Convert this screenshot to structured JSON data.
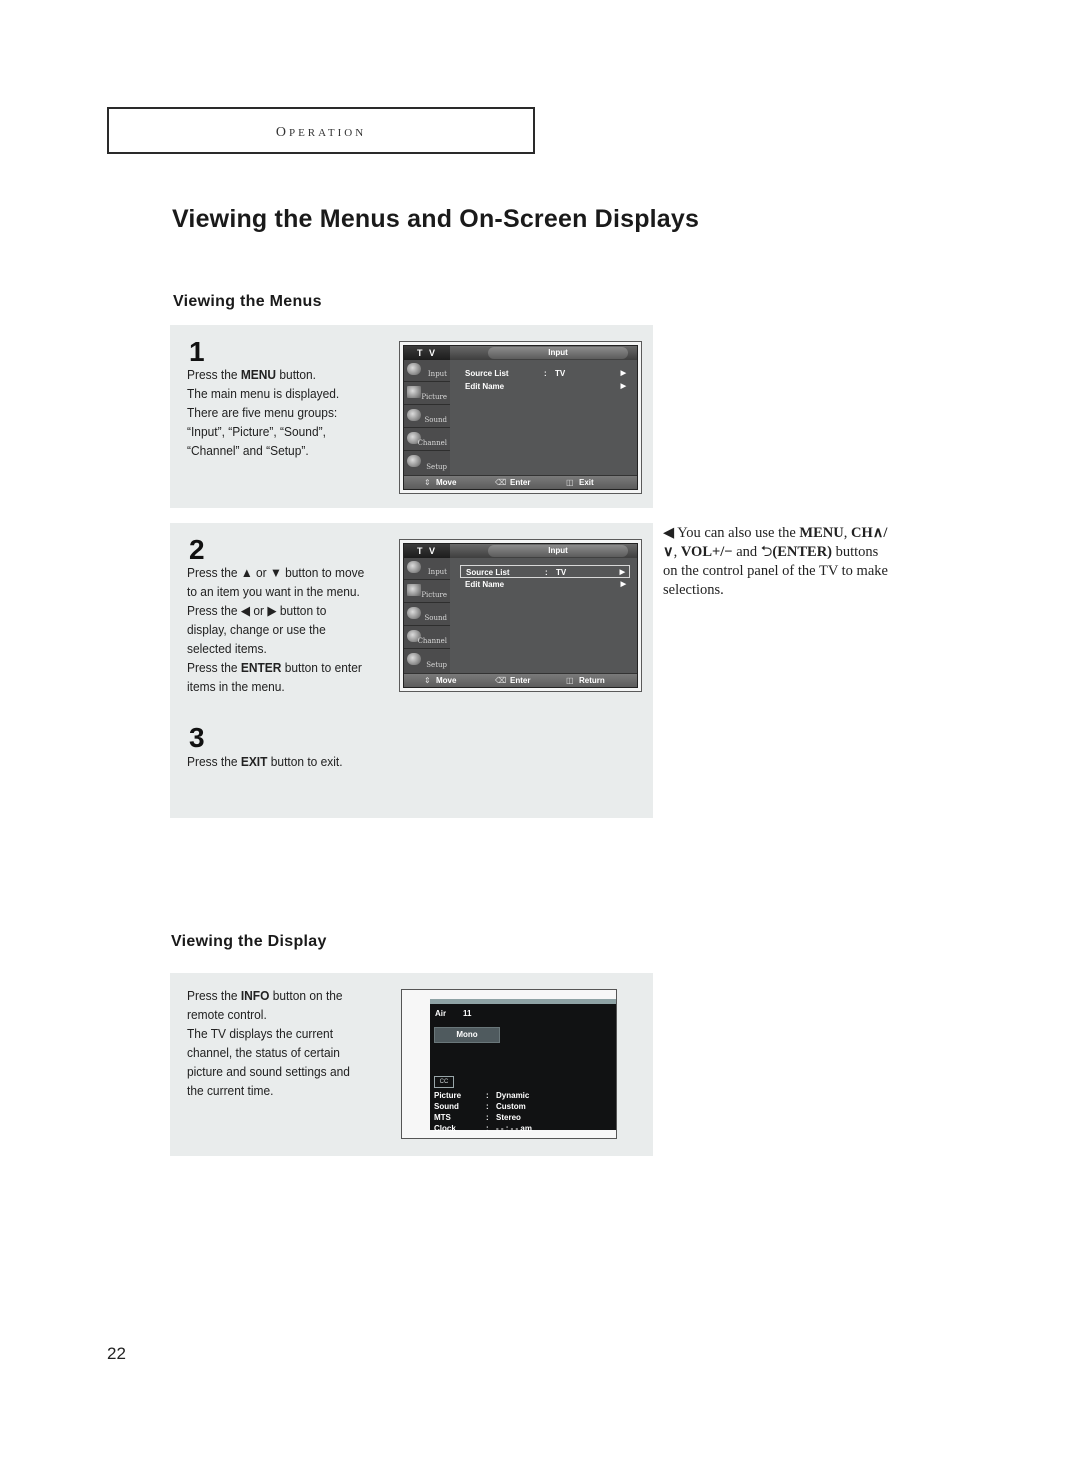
{
  "header": {
    "section_label": "Operation"
  },
  "page_title": "Viewing the Menus and On-Screen Displays",
  "menus_section": {
    "heading": "Viewing the Menus",
    "steps": [
      {
        "number": "1",
        "lines": [
          {
            "pre": "Press the ",
            "bold": "MENU",
            "post": " button."
          },
          {
            "pre": "The main menu is displayed.",
            "bold": "",
            "post": ""
          },
          {
            "pre": "There are five menu groups:",
            "bold": "",
            "post": ""
          },
          {
            "pre": "“Input”, “Picture”, “Sound”,",
            "bold": "",
            "post": ""
          },
          {
            "pre": "“Channel” and “Setup”.",
            "bold": "",
            "post": ""
          }
        ]
      },
      {
        "number": "2",
        "lines": [
          {
            "pre": "Press the ▲ or ▼ button to move",
            "bold": "",
            "post": ""
          },
          {
            "pre": "to an item you want in the menu.",
            "bold": "",
            "post": ""
          },
          {
            "pre": "Press the ◀ or ▶ button to",
            "bold": "",
            "post": ""
          },
          {
            "pre": "display, change or use the",
            "bold": "",
            "post": ""
          },
          {
            "pre": "selected items.",
            "bold": "",
            "post": ""
          },
          {
            "pre": "Press the ",
            "bold": "ENTER",
            "post": " button to enter"
          },
          {
            "pre": "items in the menu.",
            "bold": "",
            "post": ""
          }
        ]
      },
      {
        "number": "3",
        "lines": [
          {
            "pre": "Press the ",
            "bold": "EXIT",
            "post": " button to exit."
          }
        ]
      }
    ],
    "tv_menus": [
      {
        "tv_label": "T V",
        "title": "Input",
        "sidebar": [
          "Input",
          "Picture",
          "Sound",
          "Channel",
          "Setup"
        ],
        "rows": [
          {
            "label": "Source List",
            "sep": ":",
            "value": "TV",
            "arrow": "▶",
            "selected": false
          },
          {
            "label": "Edit Name",
            "sep": "",
            "value": "",
            "arrow": "▶",
            "selected": false
          }
        ],
        "footer": {
          "move": "Move",
          "enter": "Enter",
          "exit": "Exit"
        }
      },
      {
        "tv_label": "T V",
        "title": "Input",
        "sidebar": [
          "Input",
          "Picture",
          "Sound",
          "Channel",
          "Setup"
        ],
        "rows": [
          {
            "label": "Source List",
            "sep": ":",
            "value": "TV",
            "arrow": "▶",
            "selected": true
          },
          {
            "label": "Edit Name",
            "sep": "",
            "value": "",
            "arrow": "▶",
            "selected": false
          }
        ],
        "footer": {
          "move": "Move",
          "enter": "Enter",
          "exit": "Return"
        }
      }
    ],
    "note": {
      "marker": "◀",
      "t1": " You can also use the ",
      "b1": "MENU",
      "t2": ", ",
      "b2": "CH∧/∨",
      "t3": ", ",
      "b3": "VOL+/−",
      "t4": " and ",
      "enter_icon": "⮌",
      "b4": "(ENTER)",
      "t5": " buttons on the control panel of the TV to make selections."
    }
  },
  "display_section": {
    "heading": "Viewing the Display",
    "lines": [
      {
        "pre": "Press the ",
        "bold": "INFO",
        "post": " button on the"
      },
      {
        "pre": "remote control.",
        "bold": "",
        "post": ""
      },
      {
        "pre": "The TV displays the current",
        "bold": "",
        "post": ""
      },
      {
        "pre": "channel, the status of certain",
        "bold": "",
        "post": ""
      },
      {
        "pre": "picture and sound settings and",
        "bold": "",
        "post": ""
      },
      {
        "pre": "the current time.",
        "bold": "",
        "post": ""
      }
    ],
    "info_screen": {
      "source": "Air",
      "channel": "11",
      "audio": "Mono",
      "cc": "CC",
      "rows": [
        {
          "label": "Picture",
          "sep": ":",
          "value": "Dynamic"
        },
        {
          "label": "Sound",
          "sep": ":",
          "value": "Custom"
        },
        {
          "label": "MTS",
          "sep": ":",
          "value": "Stereo"
        },
        {
          "label": "Clock",
          "sep": ":",
          "value": "- - : - - am"
        }
      ]
    }
  },
  "footer": {
    "page_number": "22"
  }
}
